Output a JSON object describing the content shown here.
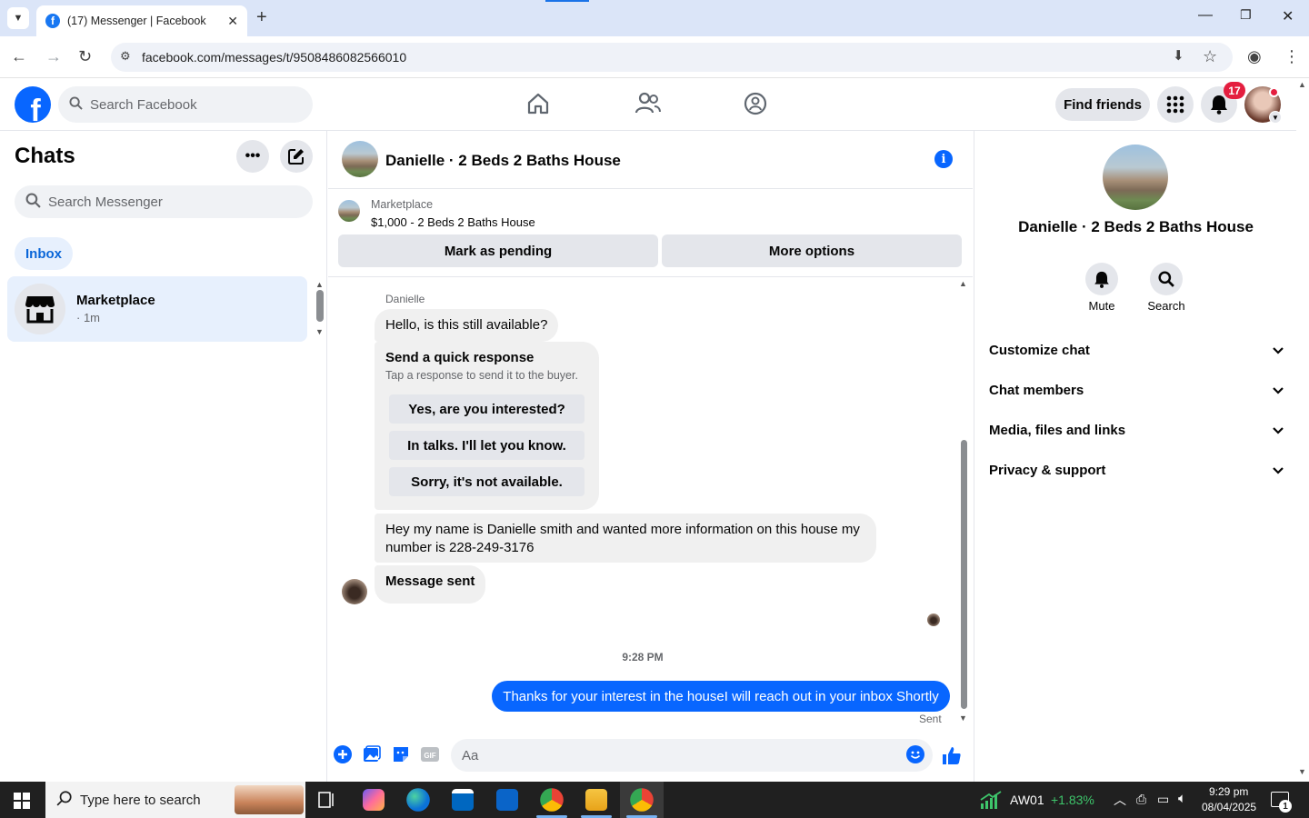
{
  "browser": {
    "tab_title": "(17) Messenger | Facebook",
    "url": "facebook.com/messages/t/9508486082566010"
  },
  "fb_header": {
    "search_placeholder": "Search Facebook",
    "find_friends": "Find friends",
    "notification_count": "17"
  },
  "left": {
    "title": "Chats",
    "search_placeholder": "Search Messenger",
    "inbox_label": "Inbox",
    "chat": {
      "name": "Marketplace",
      "time": "· 1m"
    }
  },
  "chat": {
    "header_name": "Danielle · 2 Beds 2 Baths House",
    "marketplace_label": "Marketplace",
    "listing": "$1,000 - 2 Beds 2 Baths House",
    "mark_pending": "Mark as pending",
    "more_options": "More options",
    "sender": "Danielle",
    "msg1": "Hello, is this still available?",
    "quick": {
      "title": "Send a quick response",
      "subtitle": "Tap a response to send it to the buyer.",
      "options": [
        "Yes, are you interested?",
        "In talks. I'll let you know.",
        "Sorry, it's not available."
      ]
    },
    "msg2_line1": "Hey my name is Danielle smith and wanted more information on this house my",
    "msg2_line2": "number is 228-249-3176",
    "msg3": "Message sent",
    "timestamp": "9:28 PM",
    "outgoing": "Thanks for your interest in the houseI will reach out in your inbox Shortly",
    "sent": "Sent",
    "composer_placeholder": "Aa"
  },
  "right": {
    "name": "Danielle · 2 Beds 2 Baths House",
    "mute": "Mute",
    "search": "Search",
    "sections": [
      "Customize chat",
      "Chat members",
      "Media, files and links",
      "Privacy & support"
    ]
  },
  "taskbar": {
    "search_placeholder": "Type here to search",
    "ticker": "AW01",
    "ticker_change": "+1.83%",
    "time": "9:29 pm",
    "date": "08/04/2025",
    "notif": "1"
  },
  "colors": {
    "fb_blue": "#0866ff",
    "accent_light": "#e7f0fd",
    "badge_red": "#e41e3f",
    "ticker_green": "#3ec56b"
  }
}
